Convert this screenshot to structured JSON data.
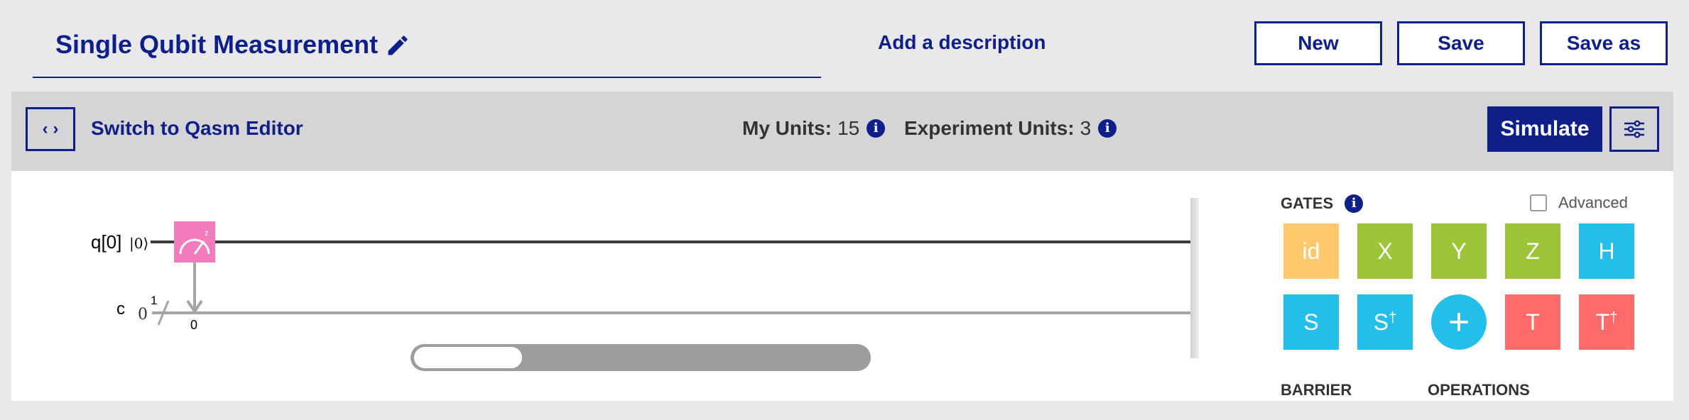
{
  "header": {
    "title": "Single Qubit Measurement",
    "add_description": "Add a description",
    "buttons": {
      "new": "New",
      "save": "Save",
      "save_as": "Save as"
    }
  },
  "toolbar": {
    "code_toggle": "‹ ›",
    "switch_label": "Switch to Qasm Editor",
    "my_units_label": "My Units:",
    "my_units_value": "15",
    "experiment_units_label": "Experiment Units:",
    "experiment_units_value": "3",
    "info_glyph": "i",
    "simulate": "Simulate"
  },
  "circuit": {
    "qubit_label": "q[0]",
    "qubit_state": "|0⟩",
    "classical_label": "c",
    "classical_initial": "0",
    "classical_width": "1",
    "measure_target": "0",
    "gate_icon": "measure-icon",
    "scroll_position": 0.2
  },
  "palette": {
    "gates_title": "GATES",
    "advanced_label": "Advanced",
    "advanced_checked": false,
    "gates": [
      {
        "label": "id",
        "sup": "",
        "color": "#ffc96b"
      },
      {
        "label": "X",
        "sup": "",
        "color": "#9cc537"
      },
      {
        "label": "Y",
        "sup": "",
        "color": "#9cc537"
      },
      {
        "label": "Z",
        "sup": "",
        "color": "#9cc537"
      },
      {
        "label": "H",
        "sup": "",
        "color": "#23bfea"
      },
      {
        "label": "S",
        "sup": "",
        "color": "#23bfea"
      },
      {
        "label": "S",
        "sup": "†",
        "color": "#23bfea"
      },
      {
        "label": "+",
        "sup": "",
        "color": "#23bfea"
      },
      {
        "label": "T",
        "sup": "",
        "color": "#ff6a6a"
      },
      {
        "label": "T",
        "sup": "†",
        "color": "#ff6a6a"
      }
    ],
    "barrier_label": "BARRIER",
    "operations_label": "OPERATIONS"
  },
  "colors": {
    "primary": "#0e1f8a",
    "measure_gate": "#f27bbd",
    "wire": "#3a3a3a",
    "classical_wire": "#a5a5a5"
  }
}
